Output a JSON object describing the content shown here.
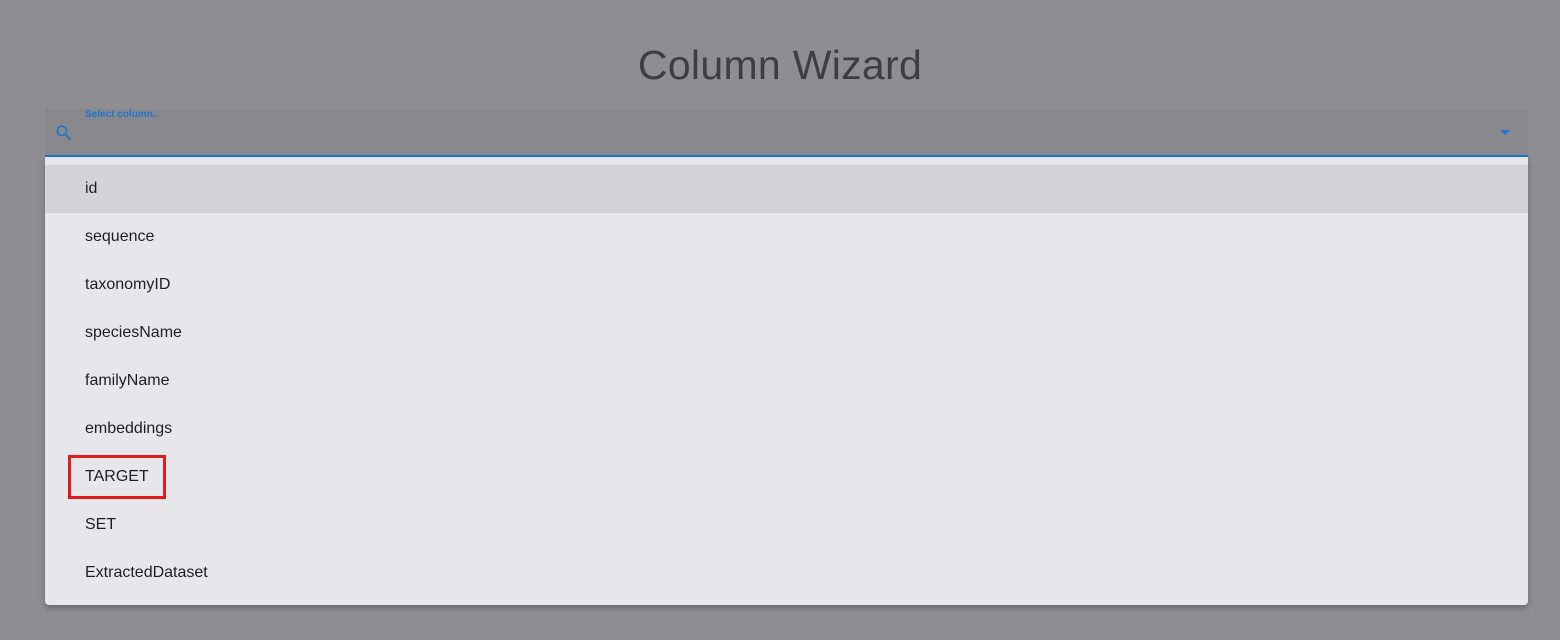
{
  "header": {
    "title": "Column Wizard"
  },
  "select": {
    "label": "Select column..",
    "value": "",
    "icons": {
      "leading": "search-icon",
      "trailing": "dropdown-arrow-icon"
    },
    "accent_color": "#1976d2"
  },
  "menu": {
    "highlighted_index": 0,
    "marked_index": 6,
    "marker_color": "#e41b1b",
    "items": [
      {
        "label": "id"
      },
      {
        "label": "sequence"
      },
      {
        "label": "taxonomyID"
      },
      {
        "label": "speciesName"
      },
      {
        "label": "familyName"
      },
      {
        "label": "embeddings"
      },
      {
        "label": "TARGET"
      },
      {
        "label": "SET"
      },
      {
        "label": "ExtractedDataset"
      }
    ]
  }
}
